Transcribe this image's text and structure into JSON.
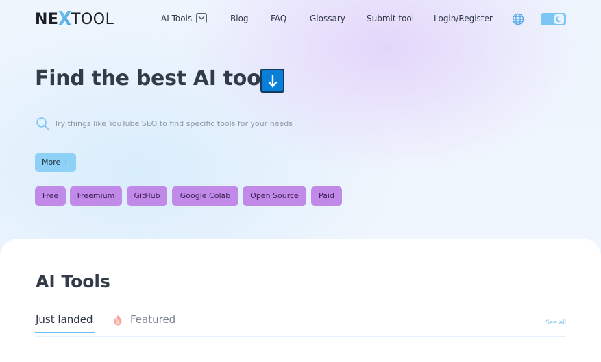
{
  "logo": {
    "part1": "NE",
    "part2": "X",
    "part3": "TOOL"
  },
  "nav": {
    "items": [
      {
        "label": "AI Tools"
      },
      {
        "label": "Blog"
      },
      {
        "label": "FAQ"
      },
      {
        "label": "Glossary"
      },
      {
        "label": "Submit tool"
      },
      {
        "label": "Login/Register"
      }
    ]
  },
  "hero": {
    "title": "Find the best AI tools",
    "title_emoji": "down-arrow-emoji",
    "search_placeholder": "Try things like YouTube SEO to find specific tools for your needs",
    "search_value": "",
    "more_button": "More +",
    "tags": [
      "Free",
      "Freemium",
      "GitHub",
      "Google Colab",
      "Open Source",
      "Paid"
    ]
  },
  "section": {
    "title": "AI Tools",
    "tabs": [
      {
        "label": "Just landed",
        "active": true
      },
      {
        "label": "Featured",
        "active": false,
        "icon": "fire-icon"
      }
    ],
    "see_all": "See all"
  },
  "colors": {
    "accent_blue": "#8fd0f7",
    "tag_purple": "#c18ae8",
    "toggle_blue": "#7cc6f6",
    "link_blue": "#7fc4f2"
  },
  "icons": [
    "search-icon",
    "globe-icon",
    "moon-icon",
    "chevron-down-icon",
    "down-arrow-emoji",
    "fire-icon"
  ]
}
